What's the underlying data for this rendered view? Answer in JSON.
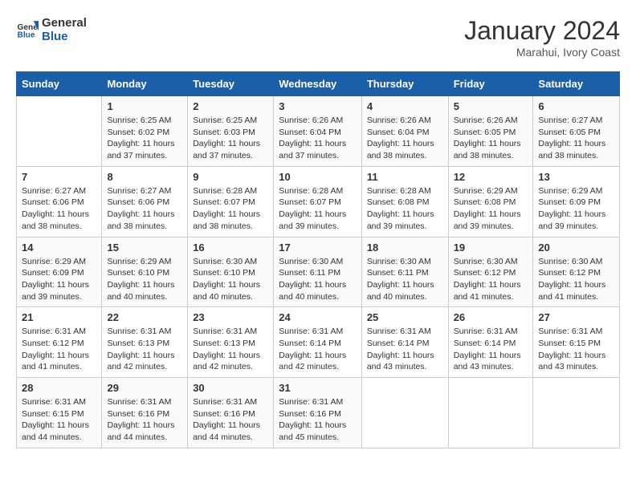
{
  "logo": {
    "line1": "General",
    "line2": "Blue"
  },
  "title": "January 2024",
  "subtitle": "Marahui, Ivory Coast",
  "days_header": [
    "Sunday",
    "Monday",
    "Tuesday",
    "Wednesday",
    "Thursday",
    "Friday",
    "Saturday"
  ],
  "weeks": [
    [
      {
        "num": "",
        "info": ""
      },
      {
        "num": "1",
        "info": "Sunrise: 6:25 AM\nSunset: 6:02 PM\nDaylight: 11 hours\nand 37 minutes."
      },
      {
        "num": "2",
        "info": "Sunrise: 6:25 AM\nSunset: 6:03 PM\nDaylight: 11 hours\nand 37 minutes."
      },
      {
        "num": "3",
        "info": "Sunrise: 6:26 AM\nSunset: 6:04 PM\nDaylight: 11 hours\nand 37 minutes."
      },
      {
        "num": "4",
        "info": "Sunrise: 6:26 AM\nSunset: 6:04 PM\nDaylight: 11 hours\nand 38 minutes."
      },
      {
        "num": "5",
        "info": "Sunrise: 6:26 AM\nSunset: 6:05 PM\nDaylight: 11 hours\nand 38 minutes."
      },
      {
        "num": "6",
        "info": "Sunrise: 6:27 AM\nSunset: 6:05 PM\nDaylight: 11 hours\nand 38 minutes."
      }
    ],
    [
      {
        "num": "7",
        "info": "Sunrise: 6:27 AM\nSunset: 6:06 PM\nDaylight: 11 hours\nand 38 minutes."
      },
      {
        "num": "8",
        "info": "Sunrise: 6:27 AM\nSunset: 6:06 PM\nDaylight: 11 hours\nand 38 minutes."
      },
      {
        "num": "9",
        "info": "Sunrise: 6:28 AM\nSunset: 6:07 PM\nDaylight: 11 hours\nand 38 minutes."
      },
      {
        "num": "10",
        "info": "Sunrise: 6:28 AM\nSunset: 6:07 PM\nDaylight: 11 hours\nand 39 minutes."
      },
      {
        "num": "11",
        "info": "Sunrise: 6:28 AM\nSunset: 6:08 PM\nDaylight: 11 hours\nand 39 minutes."
      },
      {
        "num": "12",
        "info": "Sunrise: 6:29 AM\nSunset: 6:08 PM\nDaylight: 11 hours\nand 39 minutes."
      },
      {
        "num": "13",
        "info": "Sunrise: 6:29 AM\nSunset: 6:09 PM\nDaylight: 11 hours\nand 39 minutes."
      }
    ],
    [
      {
        "num": "14",
        "info": "Sunrise: 6:29 AM\nSunset: 6:09 PM\nDaylight: 11 hours\nand 39 minutes."
      },
      {
        "num": "15",
        "info": "Sunrise: 6:29 AM\nSunset: 6:10 PM\nDaylight: 11 hours\nand 40 minutes."
      },
      {
        "num": "16",
        "info": "Sunrise: 6:30 AM\nSunset: 6:10 PM\nDaylight: 11 hours\nand 40 minutes."
      },
      {
        "num": "17",
        "info": "Sunrise: 6:30 AM\nSunset: 6:11 PM\nDaylight: 11 hours\nand 40 minutes."
      },
      {
        "num": "18",
        "info": "Sunrise: 6:30 AM\nSunset: 6:11 PM\nDaylight: 11 hours\nand 40 minutes."
      },
      {
        "num": "19",
        "info": "Sunrise: 6:30 AM\nSunset: 6:12 PM\nDaylight: 11 hours\nand 41 minutes."
      },
      {
        "num": "20",
        "info": "Sunrise: 6:30 AM\nSunset: 6:12 PM\nDaylight: 11 hours\nand 41 minutes."
      }
    ],
    [
      {
        "num": "21",
        "info": "Sunrise: 6:31 AM\nSunset: 6:12 PM\nDaylight: 11 hours\nand 41 minutes."
      },
      {
        "num": "22",
        "info": "Sunrise: 6:31 AM\nSunset: 6:13 PM\nDaylight: 11 hours\nand 42 minutes."
      },
      {
        "num": "23",
        "info": "Sunrise: 6:31 AM\nSunset: 6:13 PM\nDaylight: 11 hours\nand 42 minutes."
      },
      {
        "num": "24",
        "info": "Sunrise: 6:31 AM\nSunset: 6:14 PM\nDaylight: 11 hours\nand 42 minutes."
      },
      {
        "num": "25",
        "info": "Sunrise: 6:31 AM\nSunset: 6:14 PM\nDaylight: 11 hours\nand 43 minutes."
      },
      {
        "num": "26",
        "info": "Sunrise: 6:31 AM\nSunset: 6:14 PM\nDaylight: 11 hours\nand 43 minutes."
      },
      {
        "num": "27",
        "info": "Sunrise: 6:31 AM\nSunset: 6:15 PM\nDaylight: 11 hours\nand 43 minutes."
      }
    ],
    [
      {
        "num": "28",
        "info": "Sunrise: 6:31 AM\nSunset: 6:15 PM\nDaylight: 11 hours\nand 44 minutes."
      },
      {
        "num": "29",
        "info": "Sunrise: 6:31 AM\nSunset: 6:16 PM\nDaylight: 11 hours\nand 44 minutes."
      },
      {
        "num": "30",
        "info": "Sunrise: 6:31 AM\nSunset: 6:16 PM\nDaylight: 11 hours\nand 44 minutes."
      },
      {
        "num": "31",
        "info": "Sunrise: 6:31 AM\nSunset: 6:16 PM\nDaylight: 11 hours\nand 45 minutes."
      },
      {
        "num": "",
        "info": ""
      },
      {
        "num": "",
        "info": ""
      },
      {
        "num": "",
        "info": ""
      }
    ]
  ]
}
